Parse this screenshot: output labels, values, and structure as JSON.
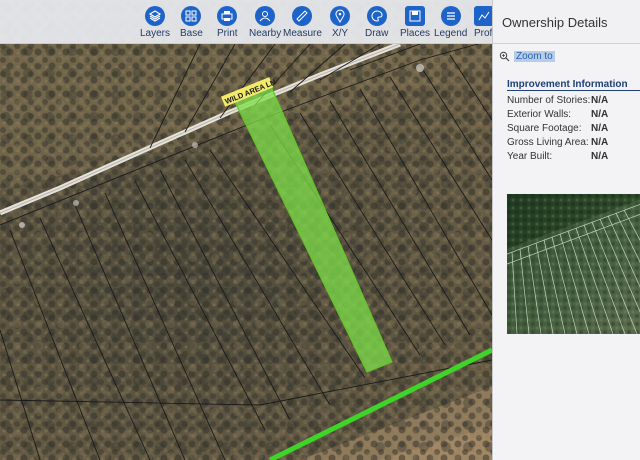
{
  "toolbar": {
    "items": [
      {
        "label": "Layers",
        "icon": "layers-icon"
      },
      {
        "label": "Base",
        "icon": "base-grid-icon"
      },
      {
        "label": "Print",
        "icon": "print-icon"
      },
      {
        "label": "Nearby",
        "icon": "nearby-icon"
      },
      {
        "label": "Measure",
        "icon": "measure-ruler-icon"
      },
      {
        "label": "X/Y",
        "icon": "location-pin-icon"
      },
      {
        "label": "Draw",
        "icon": "draw-palette-icon"
      },
      {
        "label": "Places",
        "icon": "places-save-icon"
      },
      {
        "label": "Legend",
        "icon": "legend-list-icon"
      },
      {
        "label": "Profi",
        "icon": "profile-chart-icon"
      }
    ],
    "accent": "#1d63c8"
  },
  "map": {
    "street_label": "WILD AREA LN",
    "highlight_color": "#7ee04a",
    "road_line_color": "#3fd42a"
  },
  "panel": {
    "title": "Ownership Details",
    "zoom_label": "Zoom to",
    "improvement": {
      "heading": "Improvement Information",
      "rows": [
        {
          "label": "Number of Stories:",
          "value": "N/A"
        },
        {
          "label": "Exterior Walls:",
          "value": "N/A"
        },
        {
          "label": "Square Footage:",
          "value": "N/A"
        },
        {
          "label": "Gross Living Area:",
          "value": "N/A"
        },
        {
          "label": "Year Built:",
          "value": "N/A"
        }
      ]
    }
  }
}
